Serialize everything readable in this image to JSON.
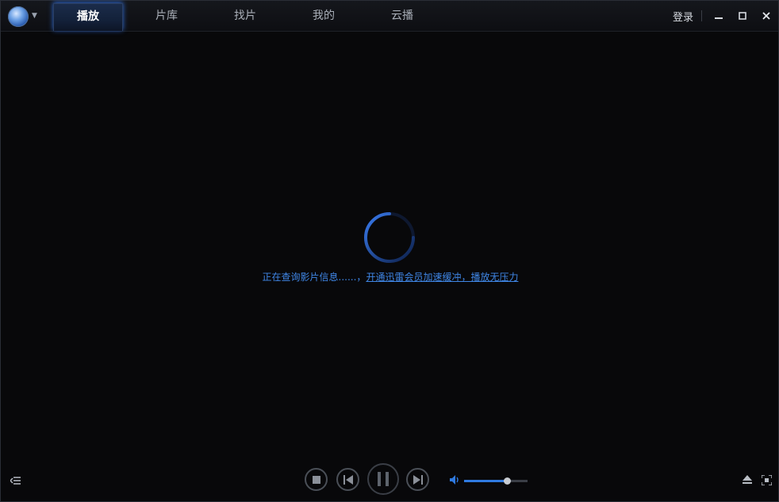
{
  "tabs": [
    {
      "label": "播放",
      "active": true
    },
    {
      "label": "片库",
      "active": false
    },
    {
      "label": "找片",
      "active": false
    },
    {
      "label": "我的",
      "active": false
    },
    {
      "label": "云播",
      "active": false
    }
  ],
  "titlebar": {
    "login_label": "登录",
    "minimize_icon": "minimize-icon",
    "maximize_icon": "maximize-icon",
    "close_icon": "close-icon"
  },
  "status": {
    "message": "正在查询影片信息......，",
    "link_text": "开通迅雷会员加速缓冲，播放无压力"
  },
  "controls": {
    "volume_level": 0.68,
    "icons": [
      "playlist-icon",
      "stop-icon",
      "previous-icon",
      "pause-icon",
      "next-icon",
      "volume-icon",
      "eject-icon",
      "fullscreen-icon"
    ]
  },
  "colors": {
    "accent": "#2f7ae0",
    "link": "#3f86e6",
    "background": "#08080a"
  }
}
